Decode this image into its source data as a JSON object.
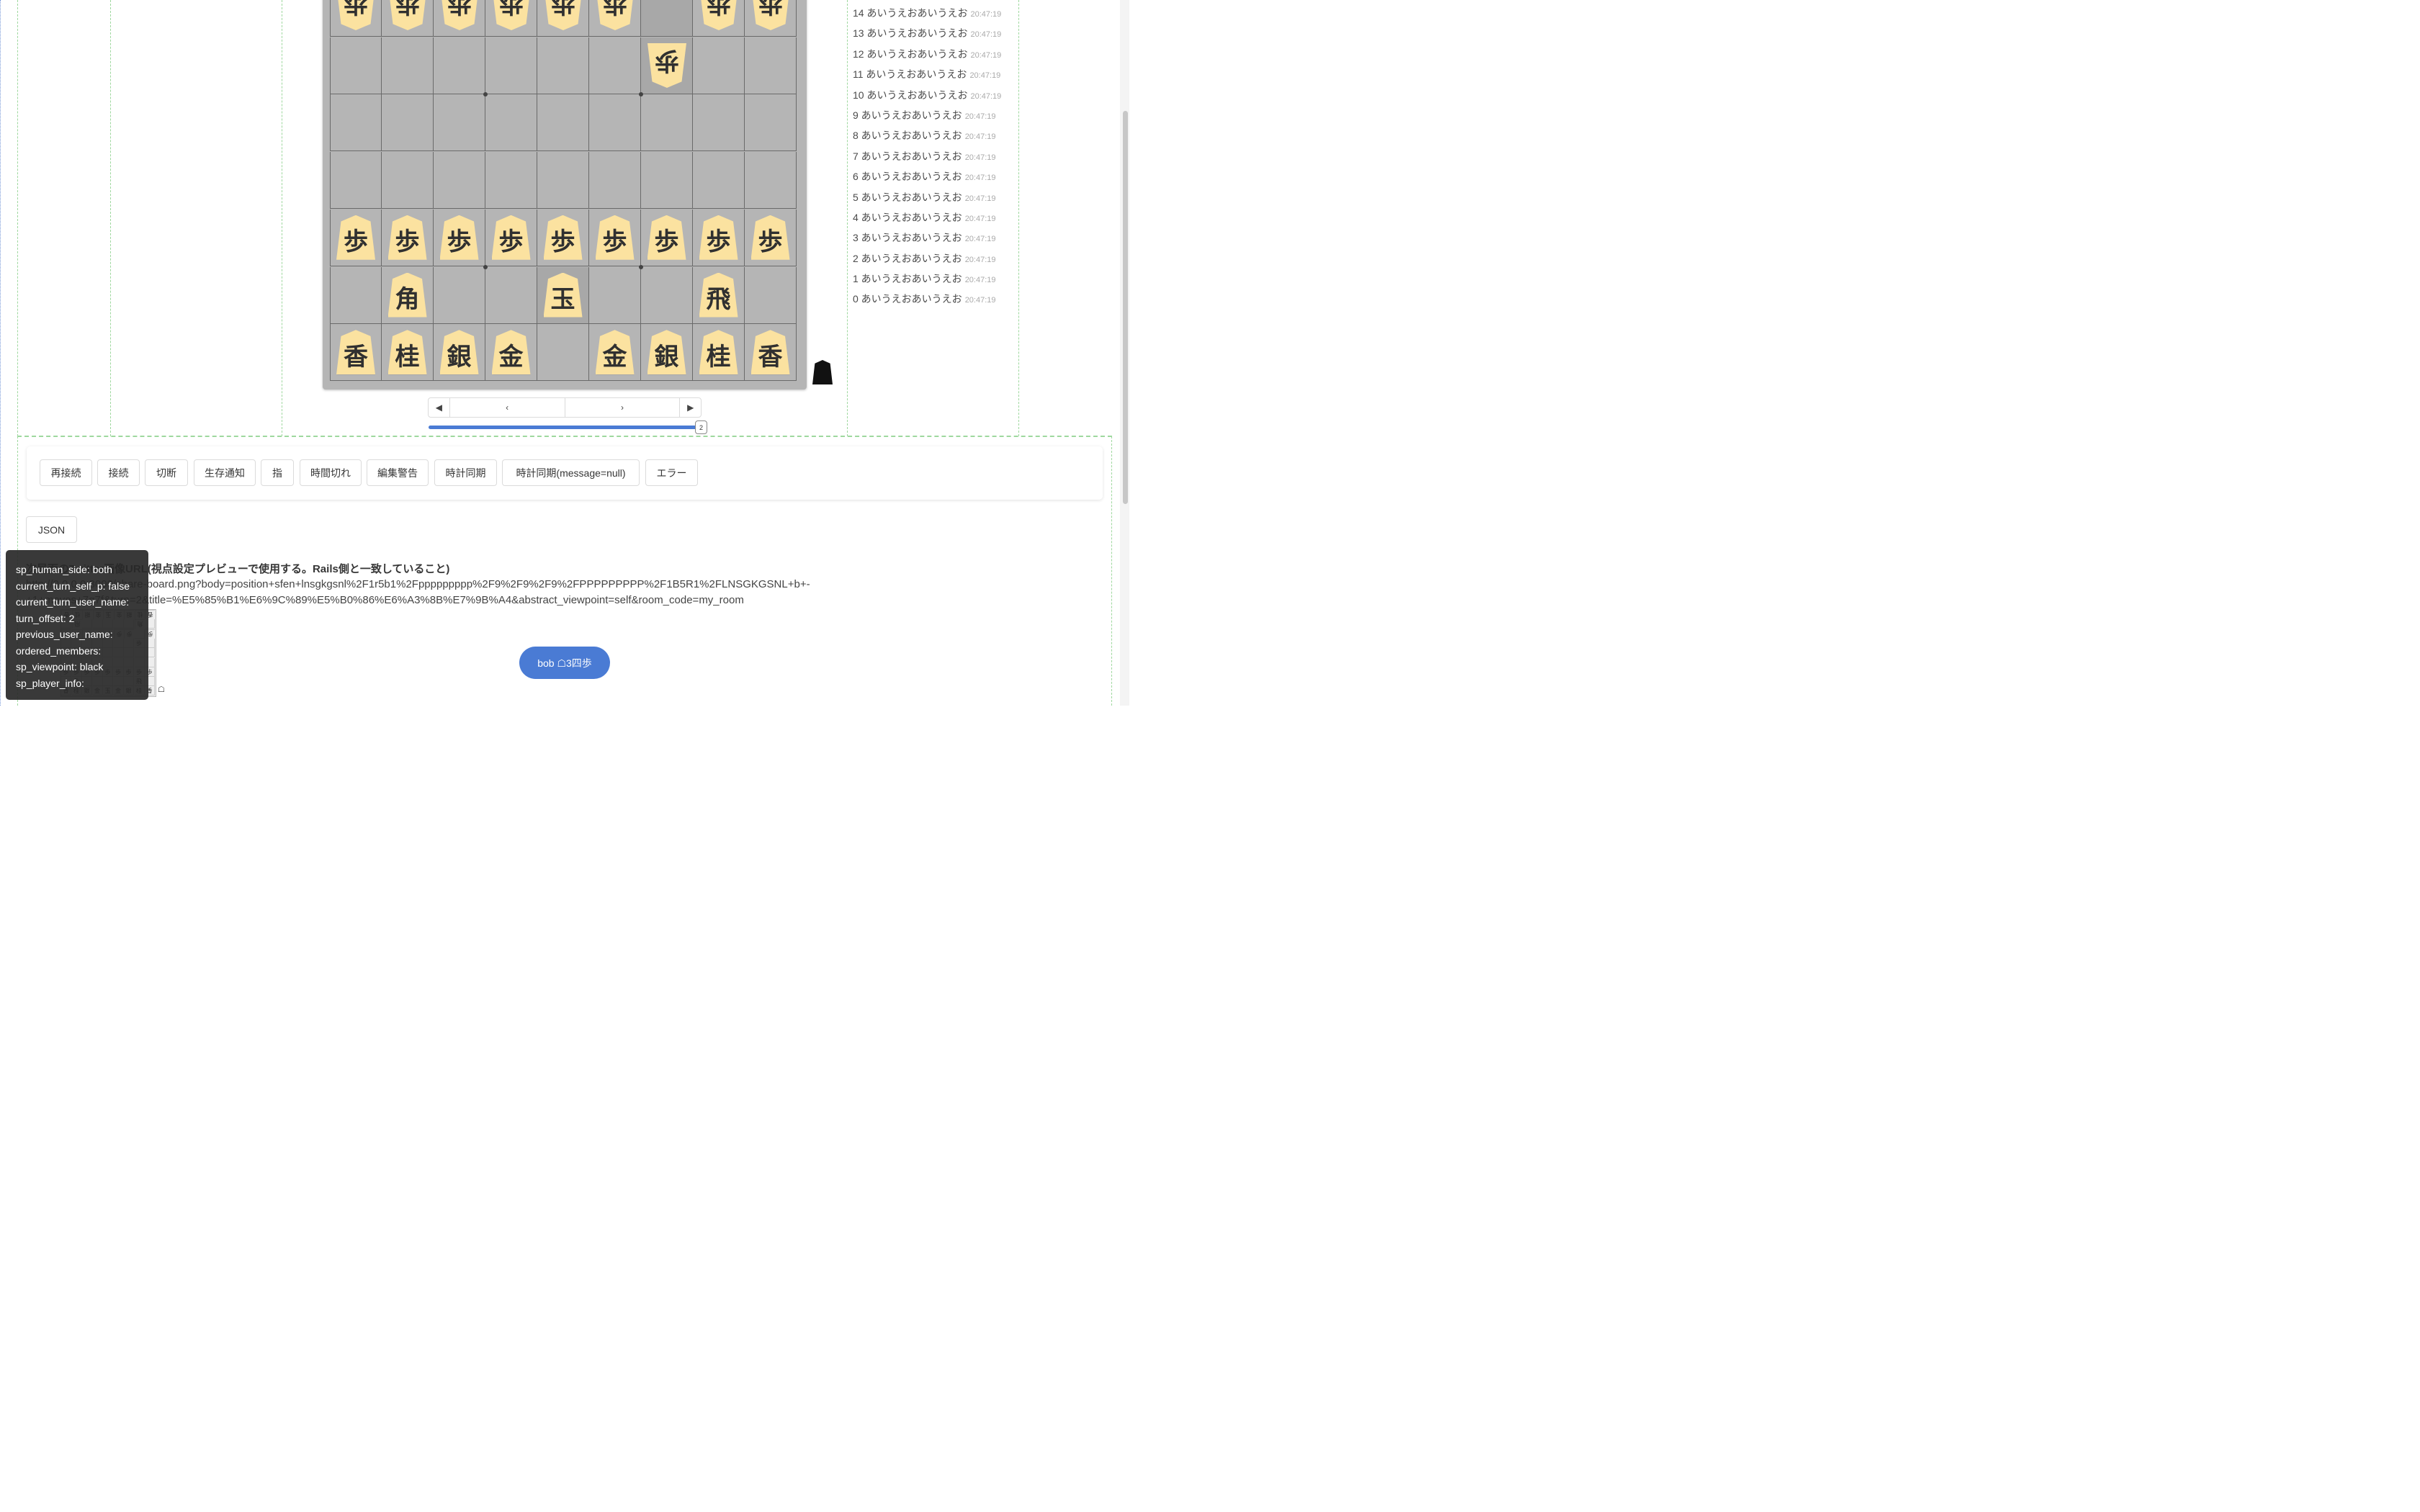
{
  "board": {
    "rows": [
      [
        "歩",
        "歩",
        "歩",
        "歩",
        "歩",
        "歩",
        "",
        "歩",
        "歩"
      ],
      [
        "",
        "",
        "",
        "",
        "",
        "",
        "歩",
        "",
        ""
      ],
      [
        "",
        "",
        "",
        "",
        "",
        "",
        "",
        "",
        ""
      ],
      [
        "",
        "",
        "",
        "",
        "",
        "",
        "",
        "",
        ""
      ],
      [
        "歩",
        "歩",
        "歩",
        "歩",
        "歩",
        "歩",
        "歩",
        "歩",
        "歩"
      ],
      [
        "",
        "角",
        "",
        "",
        "玉",
        "",
        "",
        "飛",
        ""
      ],
      [
        "香",
        "桂",
        "銀",
        "金",
        "",
        "金",
        "銀",
        "桂",
        "香"
      ]
    ],
    "inverted_rows": [
      0,
      1
    ],
    "highlight_cells": [
      [
        0,
        6
      ],
      [
        1,
        6
      ],
      [
        5,
        4
      ]
    ]
  },
  "nav": {
    "first": "◀",
    "prev": "‹",
    "next": "›",
    "last": "▶"
  },
  "slider": {
    "value": "2",
    "fraction": 1.0
  },
  "log": [
    {
      "text": "14 あいうえおあいうえお",
      "time": "20:47:19"
    },
    {
      "text": "13 あいうえおあいうえお",
      "time": "20:47:19"
    },
    {
      "text": "12 あいうえおあいうえお",
      "time": "20:47:19"
    },
    {
      "text": "11 あいうえおあいうえお",
      "time": "20:47:19"
    },
    {
      "text": "10 あいうえおあいうえお",
      "time": "20:47:19"
    },
    {
      "text": "9 あいうえおあいうえお",
      "time": "20:47:19"
    },
    {
      "text": "8 あいうえおあいうえお",
      "time": "20:47:19"
    },
    {
      "text": "7 あいうえおあいうえお",
      "time": "20:47:19"
    },
    {
      "text": "6 あいうえおあいうえお",
      "time": "20:47:19"
    },
    {
      "text": "5 あいうえおあいうえお",
      "time": "20:47:19"
    },
    {
      "text": "4 あいうえおあいうえお",
      "time": "20:47:19"
    },
    {
      "text": "3 あいうえおあいうえお",
      "time": "20:47:19"
    },
    {
      "text": "2 あいうえおあいうえお",
      "time": "20:47:19"
    },
    {
      "text": "1 あいうえおあいうえお",
      "time": "20:47:19"
    },
    {
      "text": "0 あいうえおあいうえお",
      "time": "20:47:19"
    }
  ],
  "buttons": [
    "再接続",
    "接続",
    "切断",
    "生存通知",
    "指",
    "時間切れ",
    "編集警告",
    "時計同期",
    "時計同期(message=null)",
    "エラー"
  ],
  "json_button": "JSON",
  "section_title": "次局面のTwitter画像URL(視点設定プレビューで使用する。Rails側と一致していること)",
  "url_line1": "http://0.0.0.0:3000/share-board.png?body=position+sfen+lnsgkgsnl%2F1r5b1%2Fppppppppp%2F9%2F9%2F9%2FPPPPPPPPP%2F1B5R1%2FLNSGKGSNL+b+-",
  "url_line2": "+1+moves+7g7f&turn=2&title=%E5%85%B1%E6%9C%89%E5%B0%86%E6%A3%8B%E7%9B%A4&abstract_viewpoint=self&room_code=my_room",
  "debug": [
    "sp_human_side: both",
    "current_turn_self_p: false",
    "current_turn_user_name:",
    "turn_offset: 2",
    "previous_user_name:",
    "ordered_members:",
    "sp_viewpoint: black",
    "sp_player_info:"
  ],
  "move_button": "bob ☖3四歩",
  "mini_board": {
    "rows": [
      [
        "香",
        "桂",
        "銀",
        "金",
        "玉",
        "金",
        "銀",
        "桂",
        "香"
      ],
      [
        "",
        "飛",
        "",
        "",
        "",
        "",
        "",
        "角",
        ""
      ],
      [
        "歩",
        "歩",
        "歩",
        "歩",
        "歩",
        "歩",
        "歩",
        "",
        "歩"
      ],
      [
        "",
        "",
        "",
        "",
        "",
        "",
        "",
        "歩",
        ""
      ],
      [
        "",
        "",
        "",
        "",
        "",
        "",
        "",
        "",
        ""
      ],
      [
        "",
        "",
        "",
        "",
        "",
        "",
        "",
        "",
        ""
      ],
      [
        "歩",
        "歩",
        "歩",
        "歩",
        "歩",
        "歩",
        "歩",
        "歩",
        "歩"
      ],
      [
        "",
        "角",
        "",
        "",
        "",
        "",
        "",
        "飛",
        ""
      ],
      [
        "香",
        "桂",
        "銀",
        "金",
        "玉",
        "金",
        "銀",
        "桂",
        "香"
      ]
    ],
    "hand_mark": "☖"
  },
  "colors": {
    "accent": "#4a7bd4",
    "piece": "#fbe2a0",
    "board": "#b5b5b5"
  }
}
